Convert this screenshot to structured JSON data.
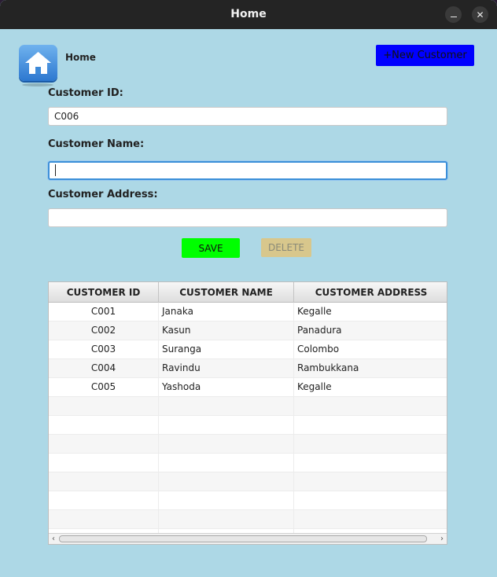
{
  "window": {
    "title": "Home",
    "minimize_glyph": "",
    "close_glyph": "✕"
  },
  "header": {
    "home_label": "Home",
    "new_customer_button": "+New Customer"
  },
  "form": {
    "customer_id_label": "Customer ID:",
    "customer_id_value": "C006",
    "customer_name_label": "Customer Name:",
    "customer_name_value": "",
    "customer_address_label": "Customer Address:",
    "customer_address_value": "",
    "save_button": "SAVE",
    "delete_button": "DELETE"
  },
  "table": {
    "columns": [
      "CUSTOMER ID",
      "CUSTOMER NAME",
      "CUSTOMER ADDRESS"
    ],
    "rows": [
      [
        "C001",
        "Janaka",
        "Kegalle"
      ],
      [
        "C002",
        "Kasun",
        "Panadura"
      ],
      [
        "C003",
        "Suranga",
        "Colombo"
      ],
      [
        "C004",
        "Ravindu",
        "Rambukkana"
      ],
      [
        "C005",
        "Yashoda",
        "Kegalle"
      ]
    ]
  },
  "colors": {
    "background": "#add8e6",
    "new_customer_button": "#0000ff",
    "save_button": "#00ff00",
    "delete_button": "#d8c78c"
  },
  "icons": {
    "home": "home-icon",
    "minimize": "minimize-icon",
    "close": "close-icon"
  }
}
